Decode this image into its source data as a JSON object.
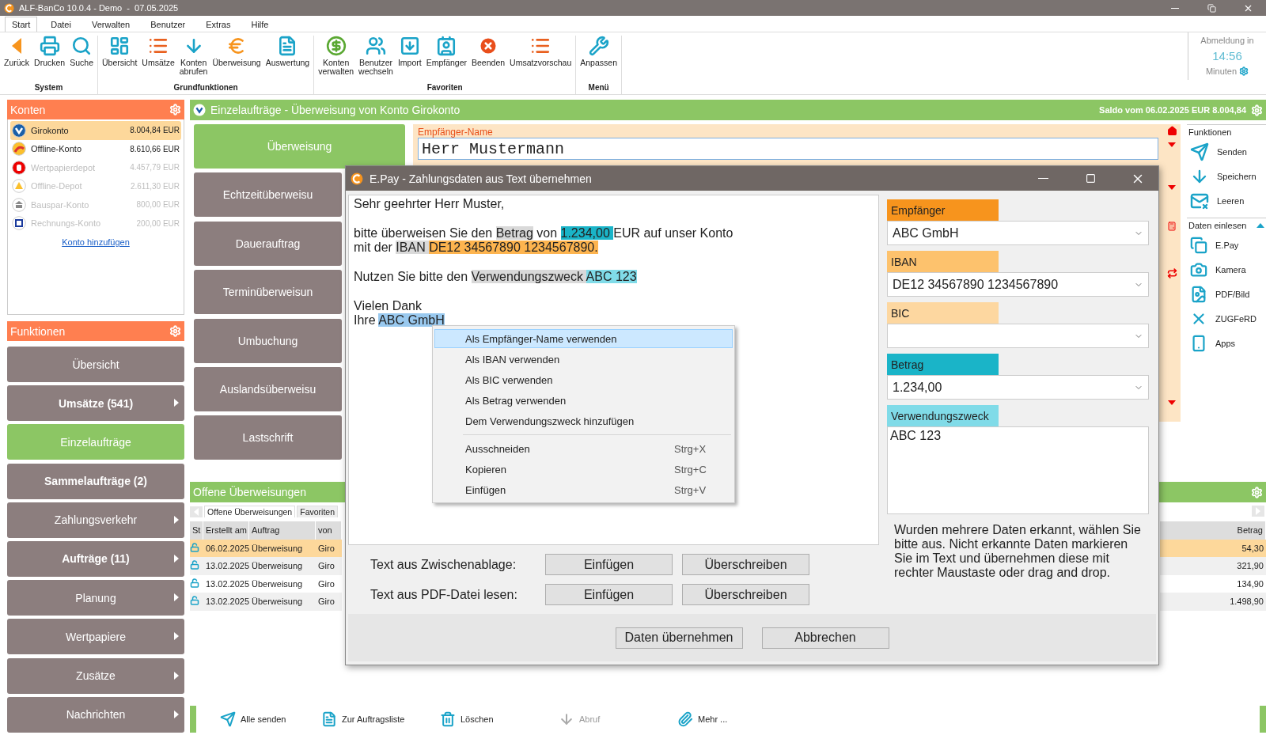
{
  "window": {
    "title": "ALF-BanCo 10.0.4 - Demo  -  07.05.2025"
  },
  "ribbon": {
    "tabs": [
      {
        "label": "Start",
        "selected": true
      },
      {
        "label": "Datei",
        "selected": false
      },
      {
        "label": "Verwalten",
        "selected": false
      },
      {
        "label": "Benutzer",
        "selected": false
      },
      {
        "label": "Extras",
        "selected": false
      },
      {
        "label": "Hilfe",
        "selected": false
      }
    ],
    "groups": [
      {
        "label": "System",
        "buttons": [
          {
            "kind": "back",
            "label": "Zurück"
          },
          {
            "kind": "printer",
            "label": "Drucken"
          },
          {
            "kind": "search",
            "label": "Suche"
          }
        ]
      },
      {
        "label": "Grundfunktionen",
        "buttons": [
          {
            "kind": "overview",
            "label": "Übersicht"
          },
          {
            "kind": "list",
            "label": "Umsätze"
          },
          {
            "kind": "download",
            "label": "Konten\nabrufen"
          },
          {
            "kind": "euro",
            "label": "Überweisung"
          },
          {
            "kind": "document",
            "label": "Auswertung"
          }
        ]
      },
      {
        "label": "Favoriten",
        "buttons": [
          {
            "kind": "moneybag",
            "label": "Konten\nverwalten"
          },
          {
            "kind": "users",
            "label": "Benutzer\nwechseln"
          },
          {
            "kind": "import",
            "label": "Import"
          },
          {
            "kind": "recipient",
            "label": "Empfänger"
          },
          {
            "kind": "quit",
            "label": "Beenden"
          },
          {
            "kind": "list",
            "label": "Umsatzvorschau"
          }
        ]
      },
      {
        "label": "Menü",
        "buttons": [
          {
            "kind": "wrench",
            "label": "Anpassen"
          }
        ]
      }
    ],
    "logout": {
      "label": "Abmeldung in",
      "time": "14:56",
      "unit": "Minuten"
    }
  },
  "sidebar": {
    "accounts": {
      "title": "Konten",
      "items": [
        {
          "kind": "vr",
          "name": "Girokonto",
          "balance": "8.004,84 EUR",
          "selected": true,
          "disabled": false
        },
        {
          "kind": "arc",
          "name": "Offline-Konto",
          "balance": "8.610,66 EUR",
          "selected": false,
          "disabled": false
        },
        {
          "kind": "s",
          "name": "Wertpapierdepot",
          "balance": "4.457,79 EUR",
          "selected": false,
          "disabled": true
        },
        {
          "kind": "triangle",
          "name": "Offline-Depot",
          "balance": "2.611,30 EUR",
          "selected": false,
          "disabled": true
        },
        {
          "kind": "bank",
          "name": "Bauspar-Konto",
          "balance": "800,00 EUR",
          "selected": false,
          "disabled": true
        },
        {
          "kind": "square",
          "name": "Rechnungs-Konto",
          "balance": "200,00 EUR",
          "selected": false,
          "disabled": true
        }
      ],
      "add_link": "Konto hinzufügen"
    },
    "functions": {
      "title": "Funktionen",
      "items": [
        {
          "label": "Übersicht",
          "selected": false,
          "bold": false,
          "arrow": false
        },
        {
          "label": "Umsätze (541)",
          "selected": false,
          "bold": true,
          "arrow": true
        },
        {
          "label": "Einzelaufträge",
          "selected": true,
          "bold": false,
          "arrow": false
        },
        {
          "label": "Sammelaufträge (2)",
          "selected": false,
          "bold": true,
          "arrow": false
        },
        {
          "label": "Zahlungsverkehr",
          "selected": false,
          "bold": false,
          "arrow": true
        },
        {
          "label": "Aufträge (11)",
          "selected": false,
          "bold": true,
          "arrow": true
        },
        {
          "label": "Planung",
          "selected": false,
          "bold": false,
          "arrow": true
        },
        {
          "label": "Wertpapiere",
          "selected": false,
          "bold": false,
          "arrow": true
        },
        {
          "label": "Zusätze",
          "selected": false,
          "bold": false,
          "arrow": true
        },
        {
          "label": "Nachrichten",
          "selected": false,
          "bold": false,
          "arrow": true
        }
      ]
    }
  },
  "main": {
    "header": {
      "title": "Einzelaufträge - Überweisung von Konto Girokonto",
      "balance": "Saldo vom 06.02.2025 EUR 8.004,84"
    },
    "order_types": [
      {
        "label": "Überweisung",
        "selected": true
      },
      {
        "label": "Echtzeitüberweisu",
        "selected": false
      },
      {
        "label": "Dauerauftrag",
        "selected": false
      },
      {
        "label": "Terminüberweisun",
        "selected": false
      },
      {
        "label": "Umbuchung",
        "selected": false
      },
      {
        "label": "Auslandsüberweisu",
        "selected": false
      },
      {
        "label": "Lastschrift",
        "selected": false
      }
    ],
    "form": {
      "label": "Empfänger-Name",
      "value": "Herr Mustermann"
    },
    "functions": {
      "title": "Funktionen",
      "items": [
        {
          "kind": "send",
          "label": "Senden"
        },
        {
          "kind": "save",
          "label": "Speichern"
        },
        {
          "kind": "clear",
          "label": "Leeren"
        }
      ]
    },
    "import": {
      "title": "Daten einlesen",
      "expanded": true,
      "items": [
        {
          "kind": "epay",
          "label": "E.Pay"
        },
        {
          "kind": "camera",
          "label": "Kamera"
        },
        {
          "kind": "pdf",
          "label": "PDF/Bild"
        },
        {
          "kind": "zugferd",
          "label": "ZUGFeRD"
        },
        {
          "kind": "apps",
          "label": "Apps"
        }
      ]
    },
    "open_transfers": {
      "title": "Offene Überweisungen",
      "tabs": [
        {
          "label": "Offene Überweisungen",
          "selected": true
        },
        {
          "label": "Favoriten",
          "selected": false
        }
      ],
      "columns": [
        "St",
        "Erstellt am",
        "Auftrag",
        "von"
      ],
      "amount_column": "Betrag",
      "rows": [
        {
          "date": "06.02.2025",
          "type": "Überweisung",
          "from": "Giro",
          "amount": "54,30",
          "selected": true
        },
        {
          "date": "13.02.2025",
          "type": "Überweisung",
          "from": "Giro",
          "amount": "321,90",
          "selected": false
        },
        {
          "date": "13.02.2025",
          "type": "Überweisung",
          "from": "Giro",
          "amount": "134,90",
          "selected": false
        },
        {
          "date": "13.02.2025",
          "type": "Überweisung",
          "from": "Giro",
          "amount": "1.498,90",
          "selected": false
        }
      ]
    },
    "toolbar": [
      {
        "kind": "send",
        "label": "Alle senden",
        "disabled": false
      },
      {
        "kind": "list",
        "label": "Zur Auftragsliste",
        "disabled": false
      },
      {
        "kind": "delete",
        "label": "Löschen",
        "disabled": false
      },
      {
        "kind": "fetch",
        "label": "Abruf",
        "disabled": true
      },
      {
        "kind": "attach",
        "label": "Mehr ...",
        "disabled": false
      }
    ]
  },
  "dialog": {
    "title": "E.Pay - Zahlungsdaten aus Text übernehmen",
    "text": [
      {
        "lines": [
          [
            {
              "text": "Sehr geehrter Herr Muster,"
            }
          ]
        ]
      },
      {
        "lines": [
          [
            {
              "text": "bitte überweisen Sie den "
            },
            {
              "text": "Betrag",
              "color": "#d9d9d9"
            },
            {
              "text": " von "
            },
            {
              "text": "1.234,00 ",
              "color": "#1ab4c8"
            },
            {
              "text": "EUR auf unser Konto"
            }
          ],
          [
            {
              "text": "mit der "
            },
            {
              "text": "IBAN ",
              "color": "#d9d9d9"
            },
            {
              "text": "DE12 34567890 1234567890.",
              "color": "#fdb44f"
            }
          ]
        ]
      },
      {
        "lines": [
          [
            {
              "text": "Nutzen Sie bitte den "
            },
            {
              "text": "Verwendungszweck ",
              "color": "#d9d9d9"
            },
            {
              "text": "ABC 123",
              "color": "#80dbe8"
            }
          ]
        ]
      },
      {
        "lines": [
          [
            {
              "text": "Vielen Dank"
            }
          ],
          [
            {
              "text": "Ihre "
            },
            {
              "text": "ABC GmbH",
              "color": "#99c9ef"
            }
          ]
        ]
      }
    ],
    "fields": [
      {
        "kind": "dropdown",
        "label": "Empfänger",
        "color": "#f7941d",
        "value": "ABC GmbH"
      },
      {
        "kind": "dropdown",
        "label": "IBAN",
        "color": "#fdc26d",
        "value": "DE12 34567890 1234567890"
      },
      {
        "kind": "dropdown",
        "label": "BIC",
        "color": "#fdd7a0"
      },
      {
        "kind": "dropdown",
        "label": "Betrag",
        "color": "#1ab4c8",
        "value": "1.234,00"
      },
      {
        "kind": "memo",
        "label": "Verwendungszweck",
        "color": "#80dbe8",
        "value": "ABC 123"
      }
    ],
    "import_rows": [
      {
        "label": "Text aus Zwischenablage:",
        "buttons": [
          "Einfügen",
          "Überschreiben"
        ]
      },
      {
        "label": "Text aus PDF-Datei lesen:",
        "buttons": [
          "Einfügen",
          "Überschreiben"
        ]
      }
    ],
    "hint": "Wurden mehrere Daten erkannt, wählen Sie bitte aus. Nicht erkannte Daten markieren Sie im Text und übernehmen diese mit rechter Maustaste oder drag and drop.",
    "buttons": [
      "Daten übernehmen",
      "Abbrechen"
    ]
  },
  "context_menu": {
    "groups": [
      [
        {
          "label": "Als Empfänger-Name verwenden",
          "selected": true
        },
        {
          "label": "Als IBAN verwenden",
          "selected": false
        },
        {
          "label": "Als BIC verwenden",
          "selected": false
        },
        {
          "label": "Als Betrag verwenden",
          "selected": false
        },
        {
          "label": "Dem Verwendungszweck hinzufügen",
          "selected": false
        }
      ],
      [
        {
          "label": "Ausschneiden",
          "shortcut": "Strg+X",
          "selected": false
        },
        {
          "label": "Kopieren",
          "shortcut": "Strg+C",
          "selected": false
        },
        {
          "label": "Einfügen",
          "shortcut": "Strg+V",
          "selected": false
        }
      ]
    ]
  }
}
